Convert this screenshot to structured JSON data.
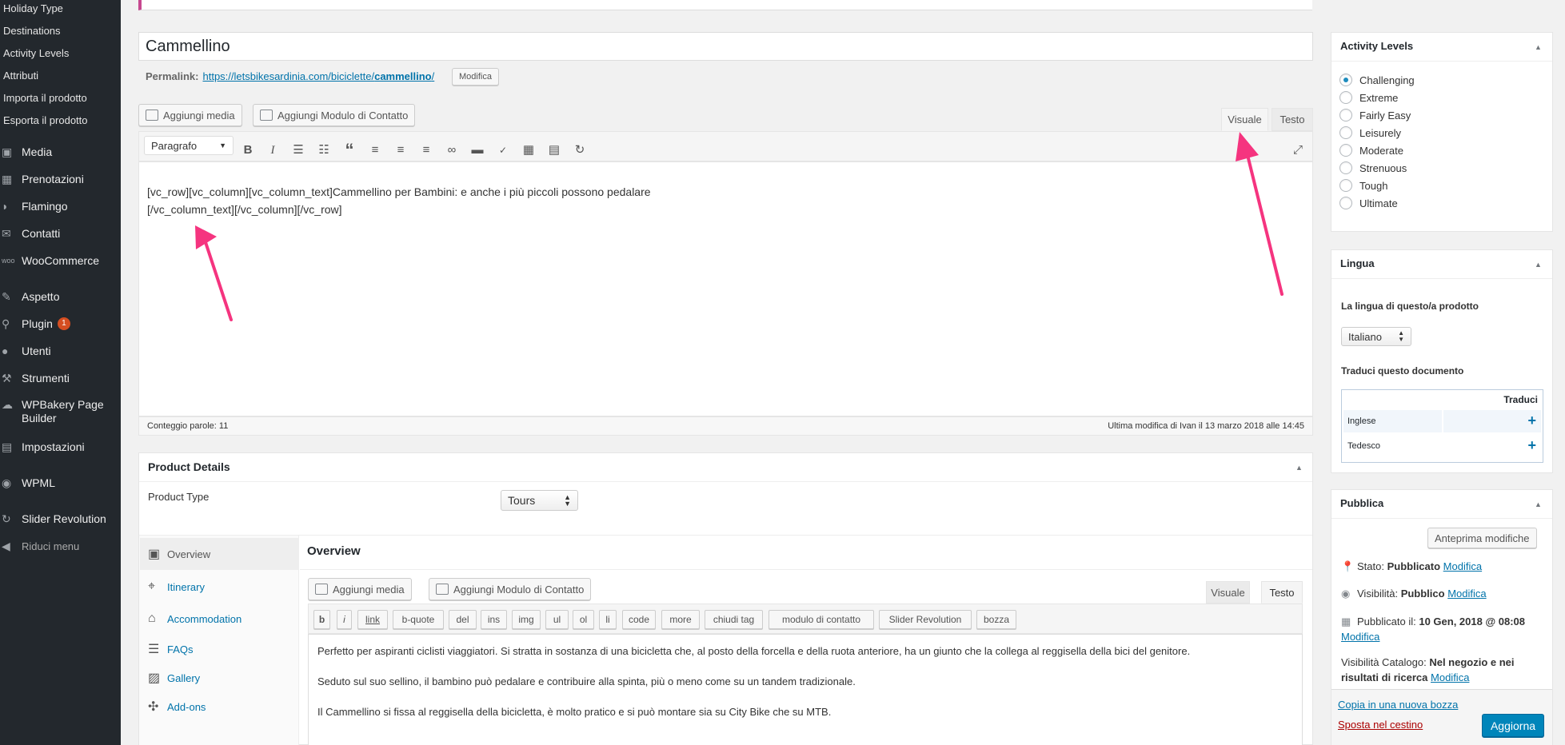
{
  "sidebar": {
    "submenu": [
      "Holiday Type",
      "Destinations",
      "Activity Levels",
      "Attributi",
      "Importa il prodotto",
      "Esporta il prodotto"
    ],
    "items": [
      {
        "label": "Media",
        "icon": "media-icon"
      },
      {
        "label": "Prenotazioni",
        "icon": "calendar-icon"
      },
      {
        "label": "Flamingo",
        "icon": "flamingo-icon"
      },
      {
        "label": "Contatti",
        "icon": "mail-icon"
      },
      {
        "label": "WooCommerce",
        "icon": "woo-icon"
      },
      {
        "label": "Aspetto",
        "icon": "brush-icon"
      },
      {
        "label": "Plugin",
        "icon": "plugin-icon",
        "badge": "1"
      },
      {
        "label": "Utenti",
        "icon": "user-icon"
      },
      {
        "label": "Strumenti",
        "icon": "wrench-icon"
      },
      {
        "label": "WPBakery Page",
        "label2": "Builder",
        "icon": "cloud-icon"
      },
      {
        "label": "Impostazioni",
        "icon": "settings-icon"
      },
      {
        "label": "WPML",
        "icon": "globe-icon"
      },
      {
        "label": "Slider Revolution",
        "icon": "refresh-icon"
      },
      {
        "label": "Riduci menu",
        "icon": "collapse-icon"
      }
    ]
  },
  "post": {
    "title": "Cammellino",
    "permalink_label": "Permalink:",
    "permalink_url": "https://letsbikesardinia.com/biciclette/cammellino/",
    "permalink_base": "https://letsbikesardinia.com/biciclette/",
    "permalink_slug": "cammellino",
    "permalink_edit": "Modifica"
  },
  "editor": {
    "add_media": "Aggiungi media",
    "add_form": "Aggiungi Modulo di Contatto",
    "tab_visual": "Visuale",
    "tab_text": "Testo",
    "format": "Paragrafo",
    "content_line1": "[vc_row][vc_column][vc_column_text]Cammellino per Bambini: e anche i più piccoli possono pedalare",
    "content_line2": "[/vc_column_text][/vc_column][/vc_row]",
    "word_count": "Conteggio parole: 11",
    "last_modified": "Ultima modifica di Ivan il 13 marzo 2018 alle 14:45"
  },
  "product": {
    "title": "Product Details",
    "type_label": "Product Type",
    "type_value": "Tours",
    "tabs": [
      {
        "label": "Overview",
        "icon": "overview-icon"
      },
      {
        "label": "Itinerary",
        "icon": "map-pin-icon"
      },
      {
        "label": "Accommodation",
        "icon": "building-icon"
      },
      {
        "label": "FAQs",
        "icon": "list-icon"
      },
      {
        "label": "Gallery",
        "icon": "image-icon"
      },
      {
        "label": "Add-ons",
        "icon": "puzzle-icon"
      }
    ],
    "section_title": "Overview",
    "add_media": "Aggiungi media",
    "add_form": "Aggiungi Modulo di Contatto",
    "tab_visual": "Visuale",
    "tab_text": "Testo",
    "quicktags": [
      "b",
      "i",
      "link",
      "b-quote",
      "del",
      "ins",
      "img",
      "ul",
      "ol",
      "li",
      "code",
      "more",
      "chiudi tag",
      "modulo di contatto",
      "Slider Revolution",
      "bozza"
    ],
    "para1": "Perfetto per aspiranti ciclisti viaggiatori. Si stratta in sostanza di una bicicletta che, al posto della forcella e della ruota anteriore, ha un giunto che la collega al reggisella della bici del genitore.",
    "para2": "Seduto sul suo sellino, il bambino può pedalare e contribuire alla spinta, più o meno come su un tandem tradizionale.",
    "para3": "Il Cammellino si fissa al reggisella della bicicletta, è molto pratico e si può montare sia su City Bike che su MTB."
  },
  "activity_levels": {
    "title": "Activity Levels",
    "options": [
      "Challenging",
      "Extreme",
      "Fairly Easy",
      "Leisurely",
      "Moderate",
      "Strenuous",
      "Tough",
      "Ultimate"
    ],
    "selected": "Challenging"
  },
  "lingua": {
    "title": "Lingua",
    "label": "La lingua di questo/a prodotto",
    "value": "Italiano",
    "translate_label": "Traduci questo documento",
    "col_header": "Traduci",
    "langs": [
      "Inglese",
      "Tedesco"
    ]
  },
  "pubblica": {
    "title": "Pubblica",
    "preview": "Anteprima modifiche",
    "stato_label": "Stato:",
    "stato_value": "Pubblicato",
    "visibilita_label": "Visibilità:",
    "visibilita_value": "Pubblico",
    "pubblicato_label": "Pubblicato il:",
    "pubblicato_value": "10 Gen, 2018 @ 08:08",
    "catalogo_label": "Visibilità Catalogo:",
    "catalogo_value1": "Nel negozio e nei",
    "catalogo_value2": "risultati di ricerca",
    "modifica": "Modifica",
    "copy": "Copia in una nuova bozza",
    "trash": "Sposta nel cestino",
    "update": "Aggiorna"
  },
  "colors": {
    "admin_bar": "#23282d",
    "accent": "#0073aa",
    "primary_button": "#0085ba",
    "annotation_arrow": "#f5347f"
  }
}
